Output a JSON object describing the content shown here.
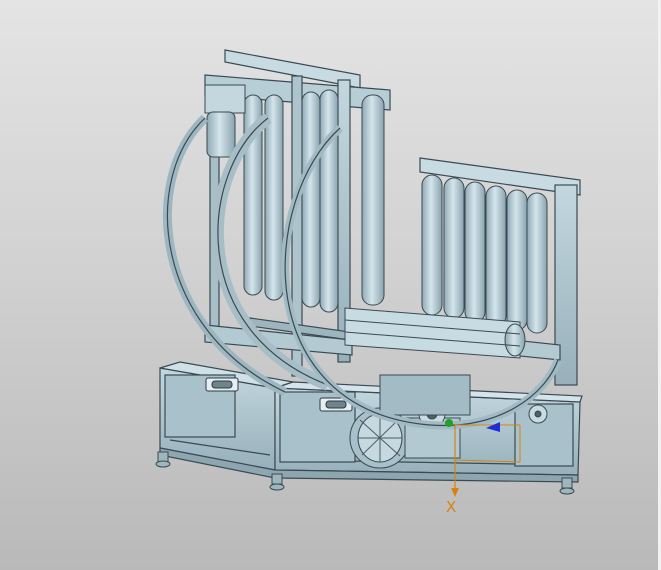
{
  "viewport": {
    "background_top": "#e4e4e4",
    "background_bottom": "#b9b9b9"
  },
  "model": {
    "fill_color": "#b6cdd6",
    "roller_color": "#c6dbe3",
    "edge_color": "#3a4a52",
    "shadow_color": "#8ea6b0"
  },
  "triad": {
    "x_label": "X",
    "x_color": "#d9820f",
    "y_color": "#1d2fd8",
    "z_color": "#23a023"
  }
}
